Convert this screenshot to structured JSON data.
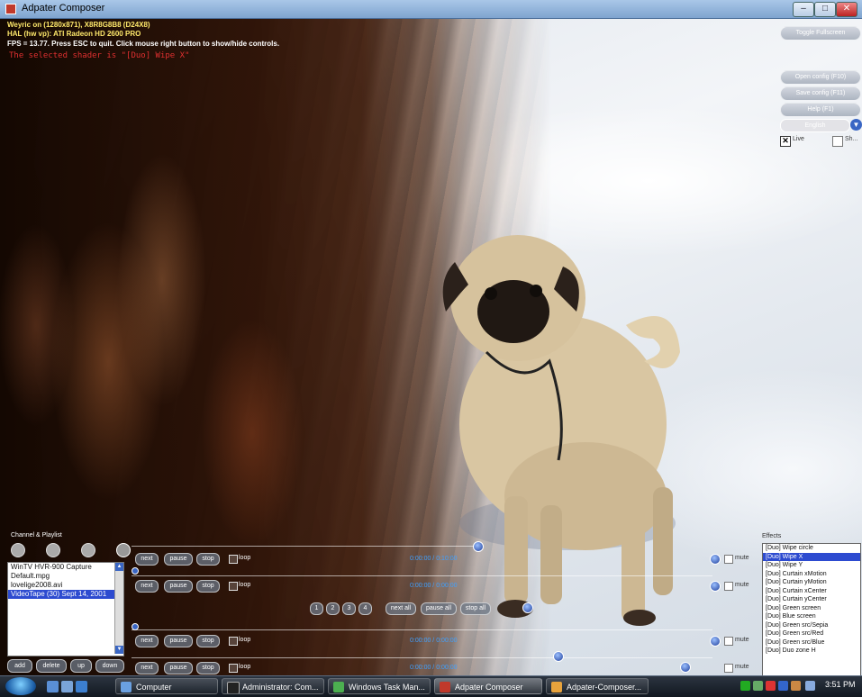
{
  "window": {
    "title": "Adpater Composer",
    "min": "–",
    "max": "□",
    "close": "✕"
  },
  "info": {
    "line1": "Weyric on (1280x871), X8R8G8B8 (D24X8)",
    "line2": "HAL (hw vp): ATI Radeon HD 2600 PRO",
    "line3": "FPS = 13.77. Press ESC to quit. Click mouse right button to show/hide controls.",
    "shader_msg": "The selected shader is \"[Duo] Wipe X\""
  },
  "controls": {
    "fullscreen": "Toggle Fullscreen",
    "open_config": "Open config (F10)",
    "save_config": "Save config (F11)",
    "help": "Help (F1)",
    "language": "English",
    "lang_arrow": "▼",
    "check1_mark": "✕",
    "check1_label": "Live",
    "check2_label": "Sh..."
  },
  "channel": {
    "title": "Channel & Playlist",
    "playlist": [
      {
        "label": "WinTV HVR-900 Capture"
      },
      {
        "label": "Default.mpg"
      },
      {
        "label": "lovelige2008.avi"
      },
      {
        "label": "VideoTape (30) Sept 14, 2001"
      }
    ],
    "buttons": {
      "add": "add",
      "delete": "delete",
      "up": "up",
      "down": "down"
    }
  },
  "rows": {
    "next": "next",
    "pause": "pause",
    "stop": "stop",
    "loop": "loop",
    "mute": "mute",
    "times": [
      "0:00:00 / 0:10:00",
      "0:00:00 / 0:00:00",
      "0:00:00 / 0:00:00",
      "0:00:00 / 0:00:00"
    ],
    "numbers": [
      "1",
      "2",
      "3",
      "4"
    ],
    "next_all": "next all",
    "pause_all": "pause all",
    "stop_all": "stop all"
  },
  "effects": {
    "title": "Effects",
    "items": [
      {
        "label": "[Duo] Wipe circle"
      },
      {
        "label": "[Duo] Wipe X"
      },
      {
        "label": "[Duo] Wipe Y"
      },
      {
        "label": "[Duo] Curtain xMotion"
      },
      {
        "label": "[Duo] Curtain yMotion"
      },
      {
        "label": "[Duo] Curtain xCenter"
      },
      {
        "label": "[Duo] Curtain yCenter"
      },
      {
        "label": "[Duo] Green screen"
      },
      {
        "label": "[Duo] Blue screen"
      },
      {
        "label": "[Duo] Green src/Sepia"
      },
      {
        "label": "[Duo] Green src/Red"
      },
      {
        "label": "[Duo] Green src/Blue"
      },
      {
        "label": "[Duo] Duo zone H"
      }
    ]
  },
  "taskbar": {
    "items": [
      {
        "label": "Computer"
      },
      {
        "label": "Administrator: Com..."
      },
      {
        "label": "Windows Task Man..."
      },
      {
        "label": "Adpater Composer"
      },
      {
        "label": "Adpater-Composer..."
      }
    ],
    "clock": "3:51 PM"
  },
  "colors": {
    "accent": "#2d4bd0",
    "shader_msg": "#e03030",
    "time_text": "#3fa0ff",
    "info_text": "#ffe96b"
  }
}
